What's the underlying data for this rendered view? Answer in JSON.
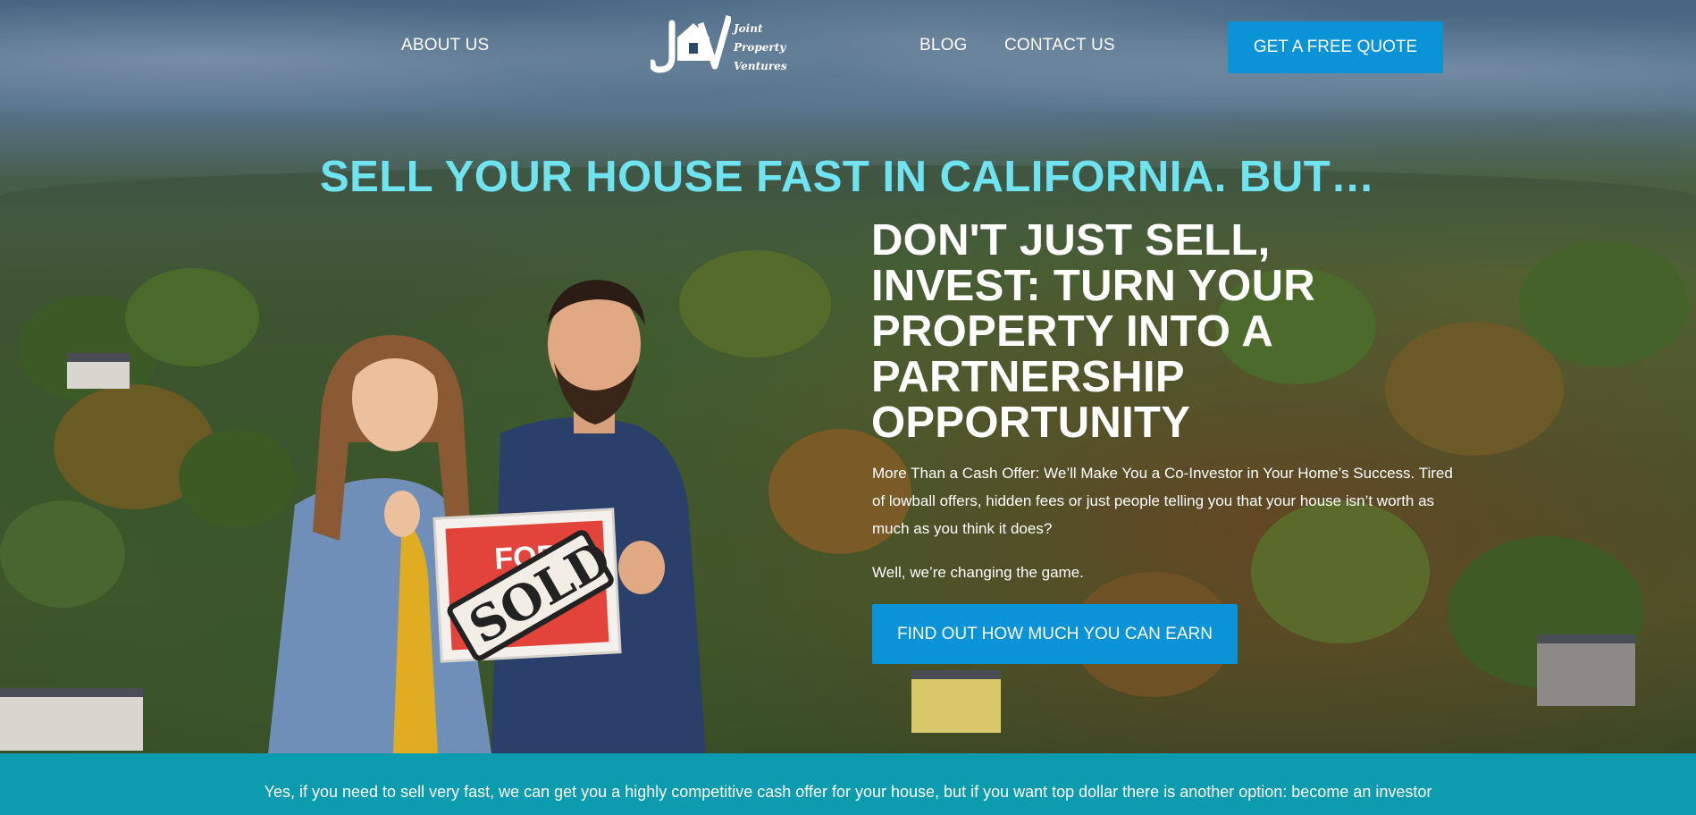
{
  "nav": {
    "about_label": "ABOUT US",
    "blog_label": "BLOG",
    "contact_label": "CONTACT US",
    "quote_button": "GET A FREE QUOTE"
  },
  "logo": {
    "monogram": "JV",
    "line1": "Joint",
    "line2": "Property",
    "line3": "Ventures"
  },
  "hero": {
    "headline": "SELL YOUR HOUSE FAST IN CALIFORNIA. BUT…",
    "subheadline": "DON'T JUST SELL, INVEST: TURN YOUR PROPERTY INTO A PARTNERSHIP OPPORTUNITY",
    "paragraph1": "More Than a Cash Offer: We’ll Make You a Co-Investor in Your Home’s Success. Tired of lowball offers, hidden fees or just people telling you that your house isn’t worth as much as you think it does?",
    "paragraph2": "Well, we’re changing the game.",
    "cta_button": "FIND OUT HOW MUCH YOU CAN EARN",
    "sign_top": "FOR",
    "sign_bottom": "SOLD"
  },
  "band": {
    "text": "Yes, if you need to sell very fast, we can get you a highly competitive cash offer for your house, but if you want top dollar there is another option: become an investor"
  },
  "colors": {
    "accent_blue": "#0a93d6",
    "headline_cyan": "#6fe3ef",
    "band_teal": "#0d9bb0"
  }
}
